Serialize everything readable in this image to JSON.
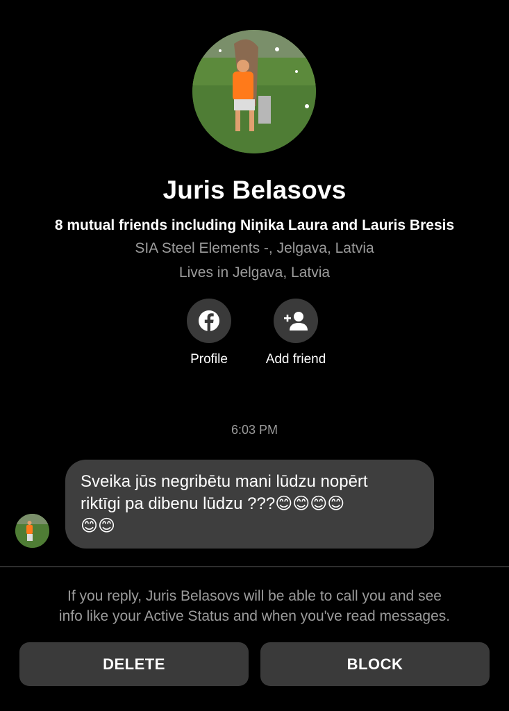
{
  "profile": {
    "name": "Juris Belasovs",
    "mutual_friends": "8 mutual friends including Niņika Laura and Lauris Bresis",
    "work": "SIA Steel Elements -, Jelgava, Latvia",
    "lives": "Lives in Jelgava, Latvia"
  },
  "actions": {
    "profile_label": "Profile",
    "add_friend_label": "Add friend"
  },
  "conversation": {
    "timestamp": "6:03 PM",
    "message_line1": "Sveika jūs negribētu mani lūdzu nopērt",
    "message_line2": "riktīgi pa dibenu lūdzu ???😊😊😊😊",
    "message_line3": "😊😊"
  },
  "notice": {
    "line1": "If you reply, Juris Belasovs will be able to call you and see",
    "line2": "info like your Active Status and when you've read messages."
  },
  "buttons": {
    "delete_label": "DELETE",
    "block_label": "BLOCK"
  },
  "colors": {
    "background": "#000000",
    "surface": "#3a3a3a",
    "secondary_text": "#9b9b9b"
  },
  "icons": {
    "profile": "facebook-icon",
    "add_friend": "add-person-icon"
  }
}
